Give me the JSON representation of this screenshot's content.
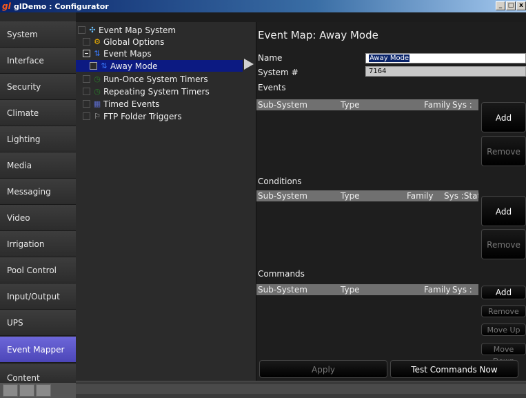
{
  "window": {
    "title": "glDemo : Configurator",
    "app_icon": "gl",
    "buttons": [
      "_",
      "□",
      "x"
    ]
  },
  "nav": {
    "items": [
      {
        "label": "System"
      },
      {
        "label": "Interface"
      },
      {
        "label": "Security"
      },
      {
        "label": "Climate"
      },
      {
        "label": "Lighting"
      },
      {
        "label": "Media"
      },
      {
        "label": "Messaging"
      },
      {
        "label": "Video"
      },
      {
        "label": "Irrigation"
      },
      {
        "label": "Pool Control"
      },
      {
        "label": "Input/Output"
      },
      {
        "label": "UPS"
      },
      {
        "label": "Event Mapper",
        "active": true
      },
      {
        "label": "Content"
      }
    ]
  },
  "tree": {
    "items": [
      {
        "label": "Event Map System",
        "icon": "event-system-icon"
      },
      {
        "label": "Global Options",
        "icon": "global-options-icon"
      },
      {
        "label": "Event Maps",
        "icon": "event-maps-icon"
      },
      {
        "label": "Away Mode",
        "icon": "event-map-icon",
        "selected": true
      },
      {
        "label": "Run-Once System Timers",
        "icon": "timer-icon"
      },
      {
        "label": "Repeating System Timers",
        "icon": "timer-icon"
      },
      {
        "label": "Timed Events",
        "icon": "calendar-icon"
      },
      {
        "label": "FTP Folder Triggers",
        "icon": "ftp-icon"
      }
    ]
  },
  "detail": {
    "title": "Event Map: Away Mode",
    "name_label": "Name",
    "name_value": "Away Mode",
    "system_label": "System #",
    "system_value": "7164",
    "events": {
      "section_label": "Events",
      "columns": [
        "Sub-System",
        "Type",
        "Family",
        "Sys :"
      ],
      "add": "Add",
      "remove": "Remove"
    },
    "conditions": {
      "section_label": "Conditions",
      "columns": [
        "Sub-System",
        "Type",
        "Family",
        "Sys :State"
      ],
      "add": "Add",
      "remove": "Remove"
    },
    "commands": {
      "section_label": "Commands",
      "columns": [
        "Sub-System",
        "Type",
        "Family",
        "Sys :"
      ],
      "add": "Add",
      "remove": "Remove",
      "move_up": "Move Up",
      "move_down": "Move Down"
    },
    "apply": "Apply",
    "test": "Test Commands Now"
  },
  "colors": {
    "nav_active": "#5a54c8",
    "tree_selected": "#0c1a82",
    "grid_header": "#707070"
  }
}
